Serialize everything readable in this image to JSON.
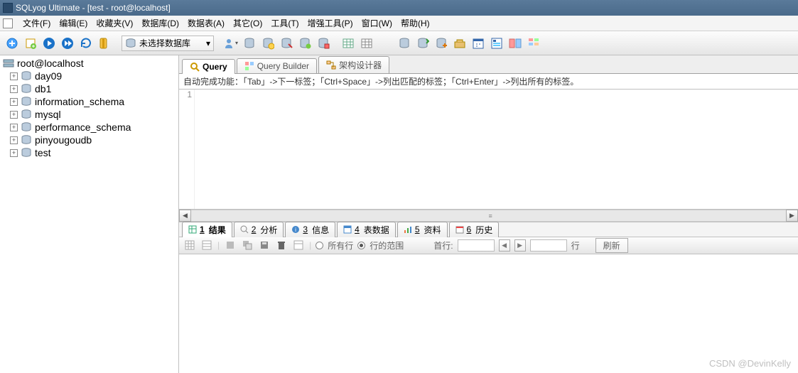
{
  "title": "SQLyog Ultimate - [test - root@localhost]",
  "menu": [
    "文件(F)",
    "编辑(E)",
    "收藏夹(V)",
    "数据库(D)",
    "数据表(A)",
    "其它(O)",
    "工具(T)",
    "增强工具(P)",
    "窗口(W)",
    "帮助(H)"
  ],
  "db_selector": "未选择数据库",
  "connection": "root@localhost",
  "databases": [
    "day09",
    "db1",
    "information_schema",
    "mysql",
    "performance_schema",
    "pinyougoudb",
    "test"
  ],
  "tabs": {
    "query": "Query",
    "builder": "Query Builder",
    "schema": "架构设计器"
  },
  "hint": "自动完成功能：「Tab」->下一标签；「Ctrl+Space」->列出匹配的标签；「Ctrl+Enter」->列出所有的标签。",
  "gutter_first_line": "1",
  "bottom_tabs": {
    "result": {
      "n": "1",
      "label": "结果"
    },
    "analyze": {
      "n": "2",
      "label": "分析"
    },
    "info": {
      "n": "3",
      "label": "信息"
    },
    "tabledata": {
      "n": "4",
      "label": "表数据"
    },
    "profile": {
      "n": "5",
      "label": "资料"
    },
    "history": {
      "n": "6",
      "label": "历史"
    }
  },
  "result_toolbar": {
    "all_rows": "所有行",
    "range_rows": "行的范围",
    "first_row": "首行:",
    "row_label": "行",
    "refresh": "刷新"
  },
  "watermark": "CSDN @DevinKelly"
}
